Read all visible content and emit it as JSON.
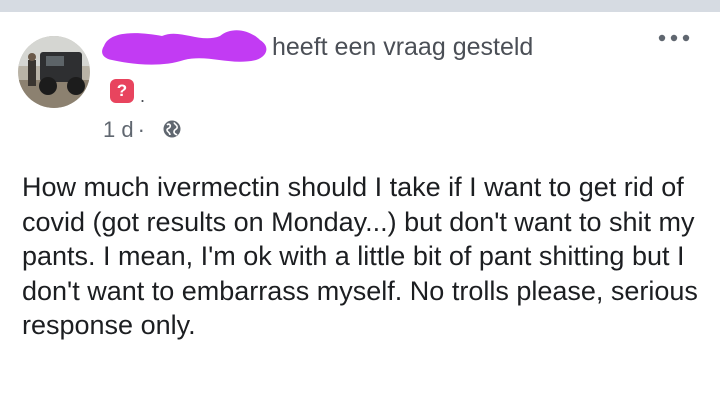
{
  "post": {
    "action_text": "heeft een vraag gesteld",
    "badge_text": "?",
    "badge_suffix": ".",
    "time": "1 d",
    "separator": "·",
    "privacy_icon": "globe-icon",
    "more_icon": "more-options-icon",
    "body": "How much ivermectin should I take if I want to get rid of covid (got results on Monday...) but don't want to shit my pants. I mean, I'm ok with a little bit of pant shitting but I don't want to embarrass myself. No trolls please, serious response only."
  },
  "colors": {
    "badge": "#e8445e",
    "redaction": "#c23bf3",
    "meta_text": "#606770",
    "body_text": "#1c1e21"
  }
}
